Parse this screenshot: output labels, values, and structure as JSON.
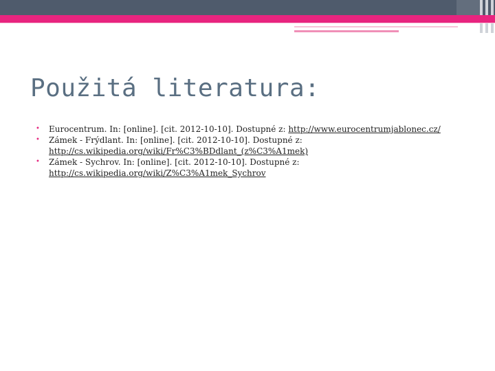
{
  "slide": {
    "title": "Použitá literatura:",
    "bullet_glyph": "•",
    "references": [
      {
        "text": "Eurocentrum. In: [online]. [cit. 2012-10-10]. Dostupné z: ",
        "link": "http://www.eurocentrumjablonec.cz/"
      },
      {
        "text": "Zámek - Frýdlant. In: [online]. [cit. 2012-10-10]. Dostupné z: ",
        "link": "http://cs.wikipedia.org/wiki/Fr%C3%BDdlant_(z%C3%A1mek)"
      },
      {
        "text": "Zámek - Sychrov. In: [online]. [cit. 2012-10-10]. Dostupné z: ",
        "link": "http://cs.wikipedia.org/wiki/Z%C3%A1mek_Sychrov"
      }
    ]
  },
  "colors": {
    "band": "#4f5b6c",
    "accent_pink": "#e8247f",
    "title": "#5a6f82",
    "bullet": "#e5287f"
  }
}
